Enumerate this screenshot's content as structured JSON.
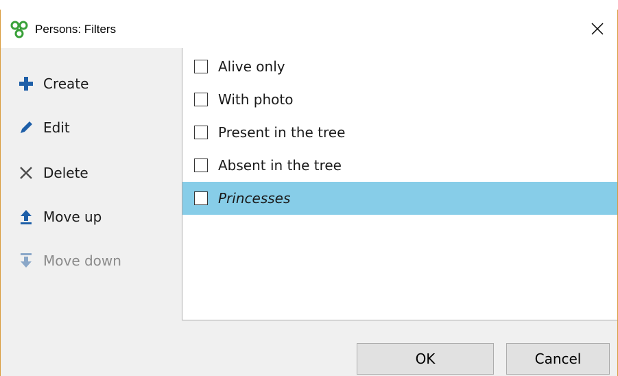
{
  "window": {
    "title": "Persons: Filters"
  },
  "icons": {
    "app": "app-logo-icon",
    "close": "close-icon"
  },
  "sidebar": {
    "items": [
      {
        "label": "Create",
        "icon": "plus-icon",
        "enabled": true
      },
      {
        "label": "Edit",
        "icon": "pencil-icon",
        "enabled": true
      },
      {
        "label": "Delete",
        "icon": "x-icon",
        "enabled": true
      },
      {
        "label": "Move up",
        "icon": "arrow-up-icon",
        "enabled": true
      },
      {
        "label": "Move down",
        "icon": "arrow-down-icon",
        "enabled": false
      }
    ]
  },
  "filters": [
    {
      "label": "Alive only",
      "checked": false,
      "selected": false
    },
    {
      "label": "With photo",
      "checked": false,
      "selected": false
    },
    {
      "label": "Present in the tree",
      "checked": false,
      "selected": false
    },
    {
      "label": "Absent in the tree",
      "checked": false,
      "selected": false
    },
    {
      "label": "Princesses",
      "checked": false,
      "selected": true
    }
  ],
  "buttons": {
    "ok": "OK",
    "cancel": "Cancel"
  },
  "colors": {
    "accent_icon": "#1e5fa8",
    "selection": "#87cde8",
    "window_border": "#d99a3a",
    "logo": "#3aa13a"
  }
}
